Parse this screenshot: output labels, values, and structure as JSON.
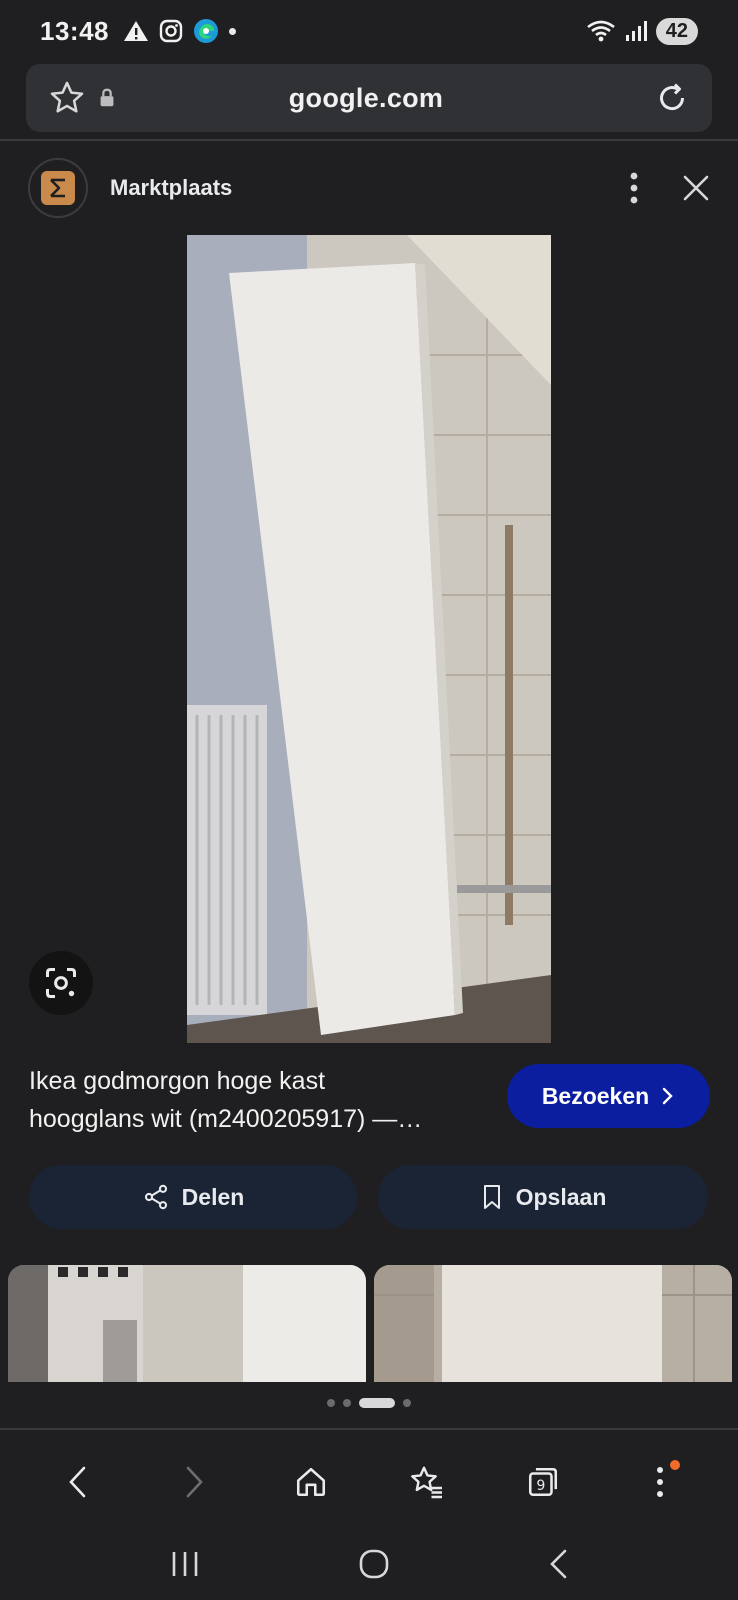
{
  "status_bar": {
    "time": "13:48",
    "battery": "42"
  },
  "address_bar": {
    "url": "google.com"
  },
  "source": {
    "name": "Marktplaats"
  },
  "result": {
    "title": "Ikea godmorgon hoge kast\nhoogglans wit (m2400205917) —…",
    "visit_label": "Bezoeken"
  },
  "actions": {
    "share_label": "Delen",
    "save_label": "Opslaan"
  },
  "toolbar": {
    "tab_count": "9"
  },
  "colors": {
    "background": "#1f1f21",
    "visit_button": "#0b1ea0",
    "action_pill": "#1a2435",
    "notification": "#f26b2a"
  },
  "icons": [
    "warning-icon",
    "instagram-icon",
    "edge-icon",
    "wifi-icon",
    "signal-icon",
    "star-icon",
    "lock-icon",
    "reload-icon",
    "more-vert-icon",
    "close-icon",
    "lens-icon",
    "chevron-right-icon",
    "share-icon",
    "bookmark-icon",
    "back-icon",
    "forward-icon",
    "home-icon",
    "bookmarks-icon",
    "tabs-icon",
    "menu-icon",
    "recents-icon",
    "home-nav-icon",
    "back-nav-icon"
  ]
}
